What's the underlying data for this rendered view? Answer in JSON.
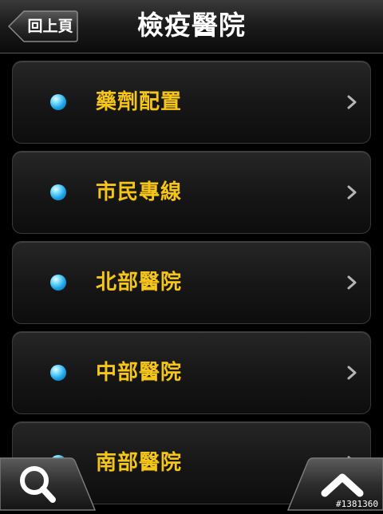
{
  "header": {
    "back_label": "回上頁",
    "title": "檢疫醫院"
  },
  "list": {
    "items": [
      {
        "label": "藥劑配置"
      },
      {
        "label": "市民專線"
      },
      {
        "label": "北部醫院"
      },
      {
        "label": "中部醫院"
      },
      {
        "label": "南部醫院"
      }
    ]
  },
  "icons": {
    "bullet": "blue-orb-icon",
    "chevron": "chevron-right-icon",
    "search": "search-icon",
    "up": "chevron-up-icon"
  },
  "colors": {
    "label": "#f5c518",
    "bullet": "#1aa3e6"
  },
  "watermark": "#1381360"
}
